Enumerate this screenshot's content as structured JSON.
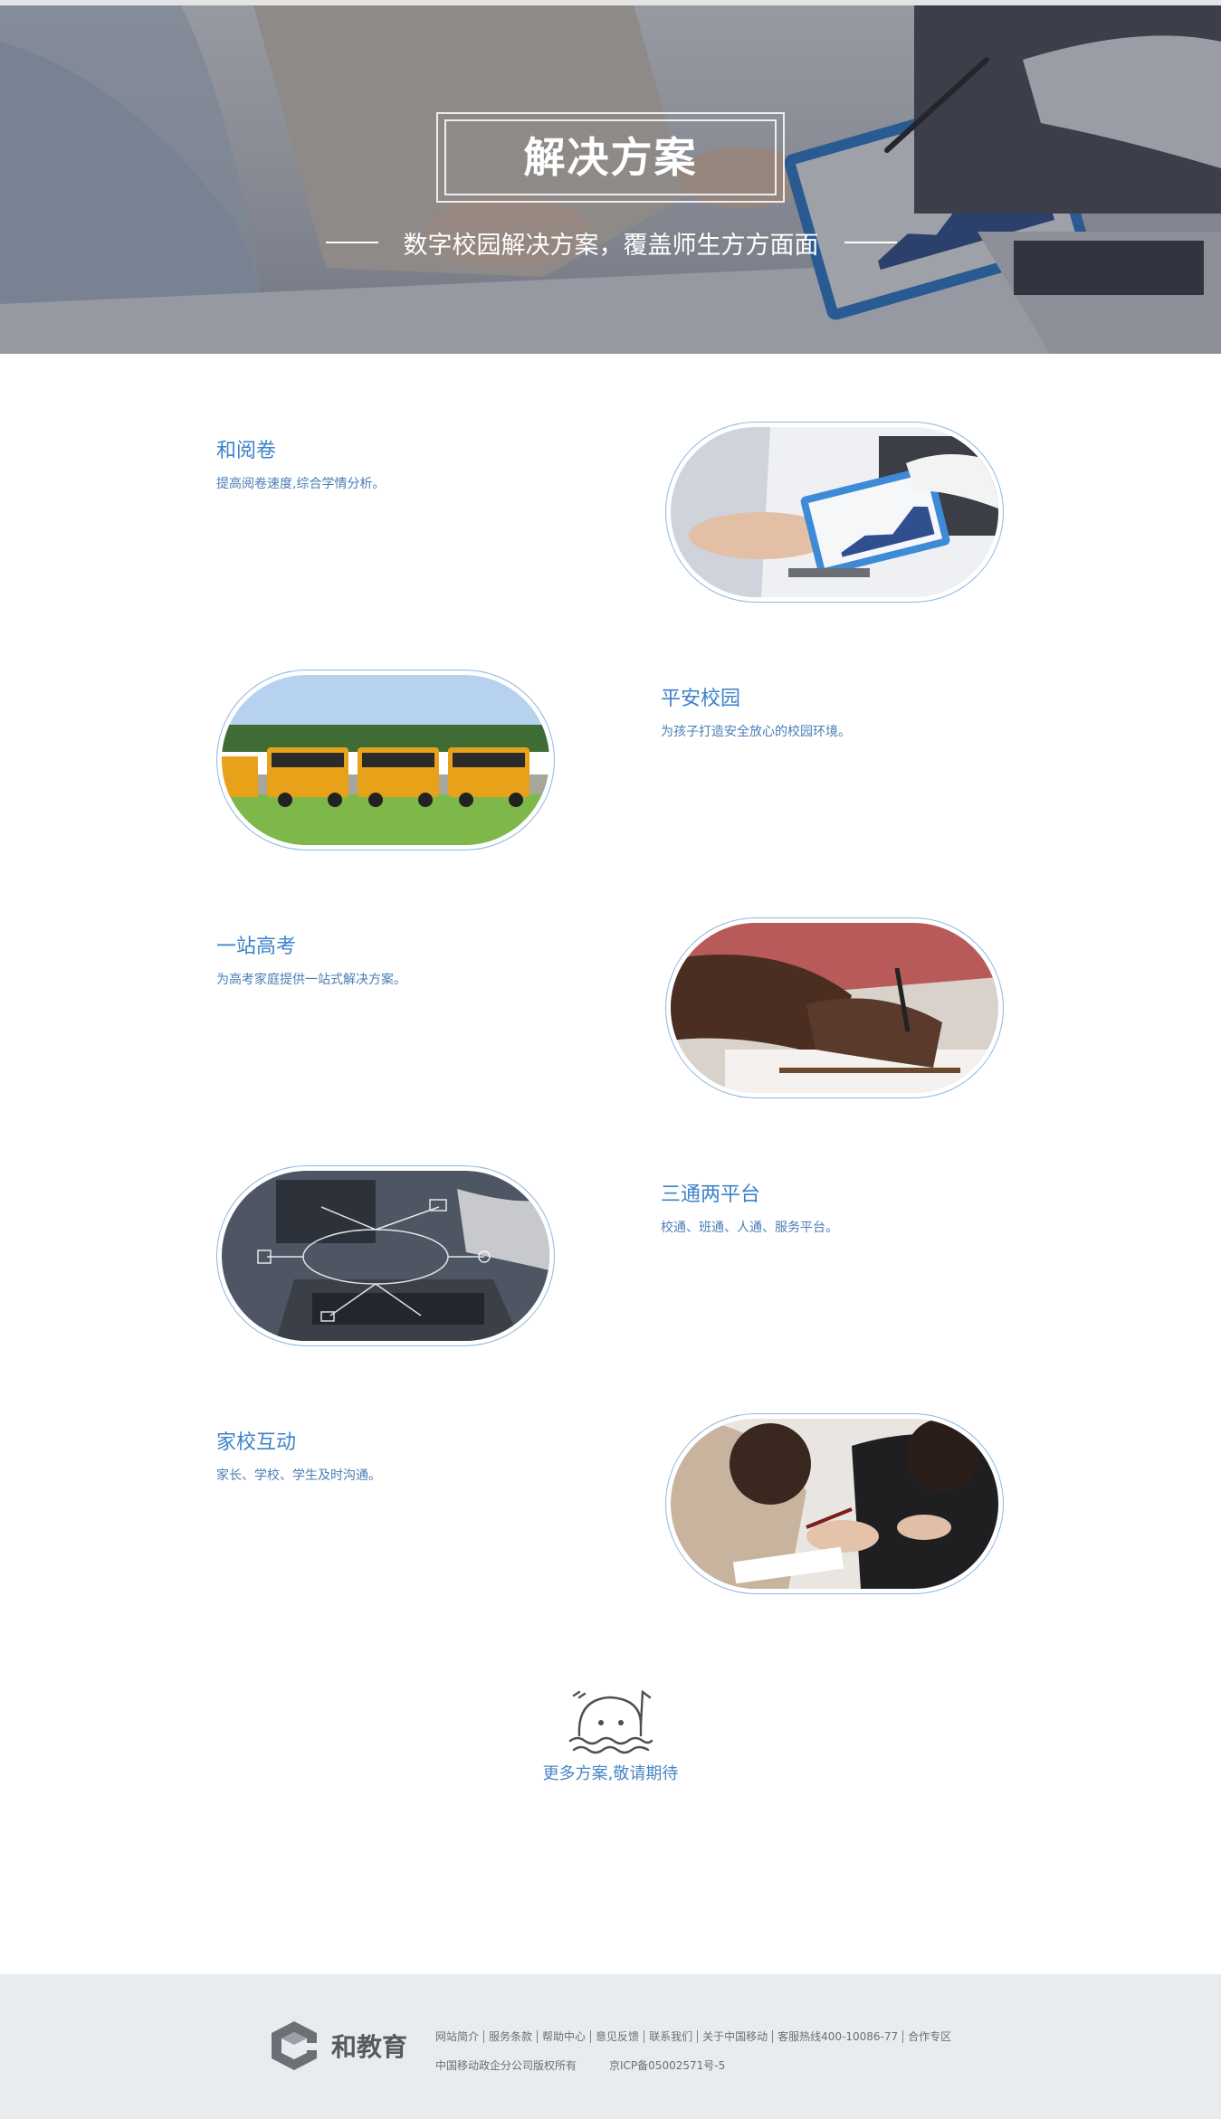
{
  "hero": {
    "title": "解决方案",
    "subtitle": "数字校园解决方案，覆盖师生方方面面"
  },
  "solutions": [
    {
      "title": "和阅卷",
      "desc": "提高阅卷速度,综合学情分析。",
      "image": "tablet-chart-photo"
    },
    {
      "title": "平安校园",
      "desc": "为孩子打造安全放心的校园环境。",
      "image": "school-bus-photo"
    },
    {
      "title": "一站高考",
      "desc": "为高考家庭提供一站式解决方案。",
      "image": "writing-exam-photo"
    },
    {
      "title": "三通两平台",
      "desc": "校通、班通、人通、服务平台。",
      "image": "laptop-network-photo"
    },
    {
      "title": "家校互动",
      "desc": "家长、学校、学生及时沟通。",
      "image": "parents-meeting-photo"
    }
  ],
  "more": {
    "text": "更多方案,敬请期待",
    "icon": "smiling-mascot-icon"
  },
  "footer": {
    "logo_text": "和教育",
    "links": [
      "网站简介",
      "服务条款",
      "帮助中心",
      "意见反馈",
      "联系我们",
      "关于中国移动",
      "客服热线400-10086-77",
      "合作专区"
    ],
    "copyright": "中国移动政企分公司版权所有",
    "icp": "京ICP备05002571号-5"
  },
  "colors": {
    "accent": "#3d82c9",
    "footer_bg": "#e9ecef",
    "pic_border": "#8fb7df"
  }
}
